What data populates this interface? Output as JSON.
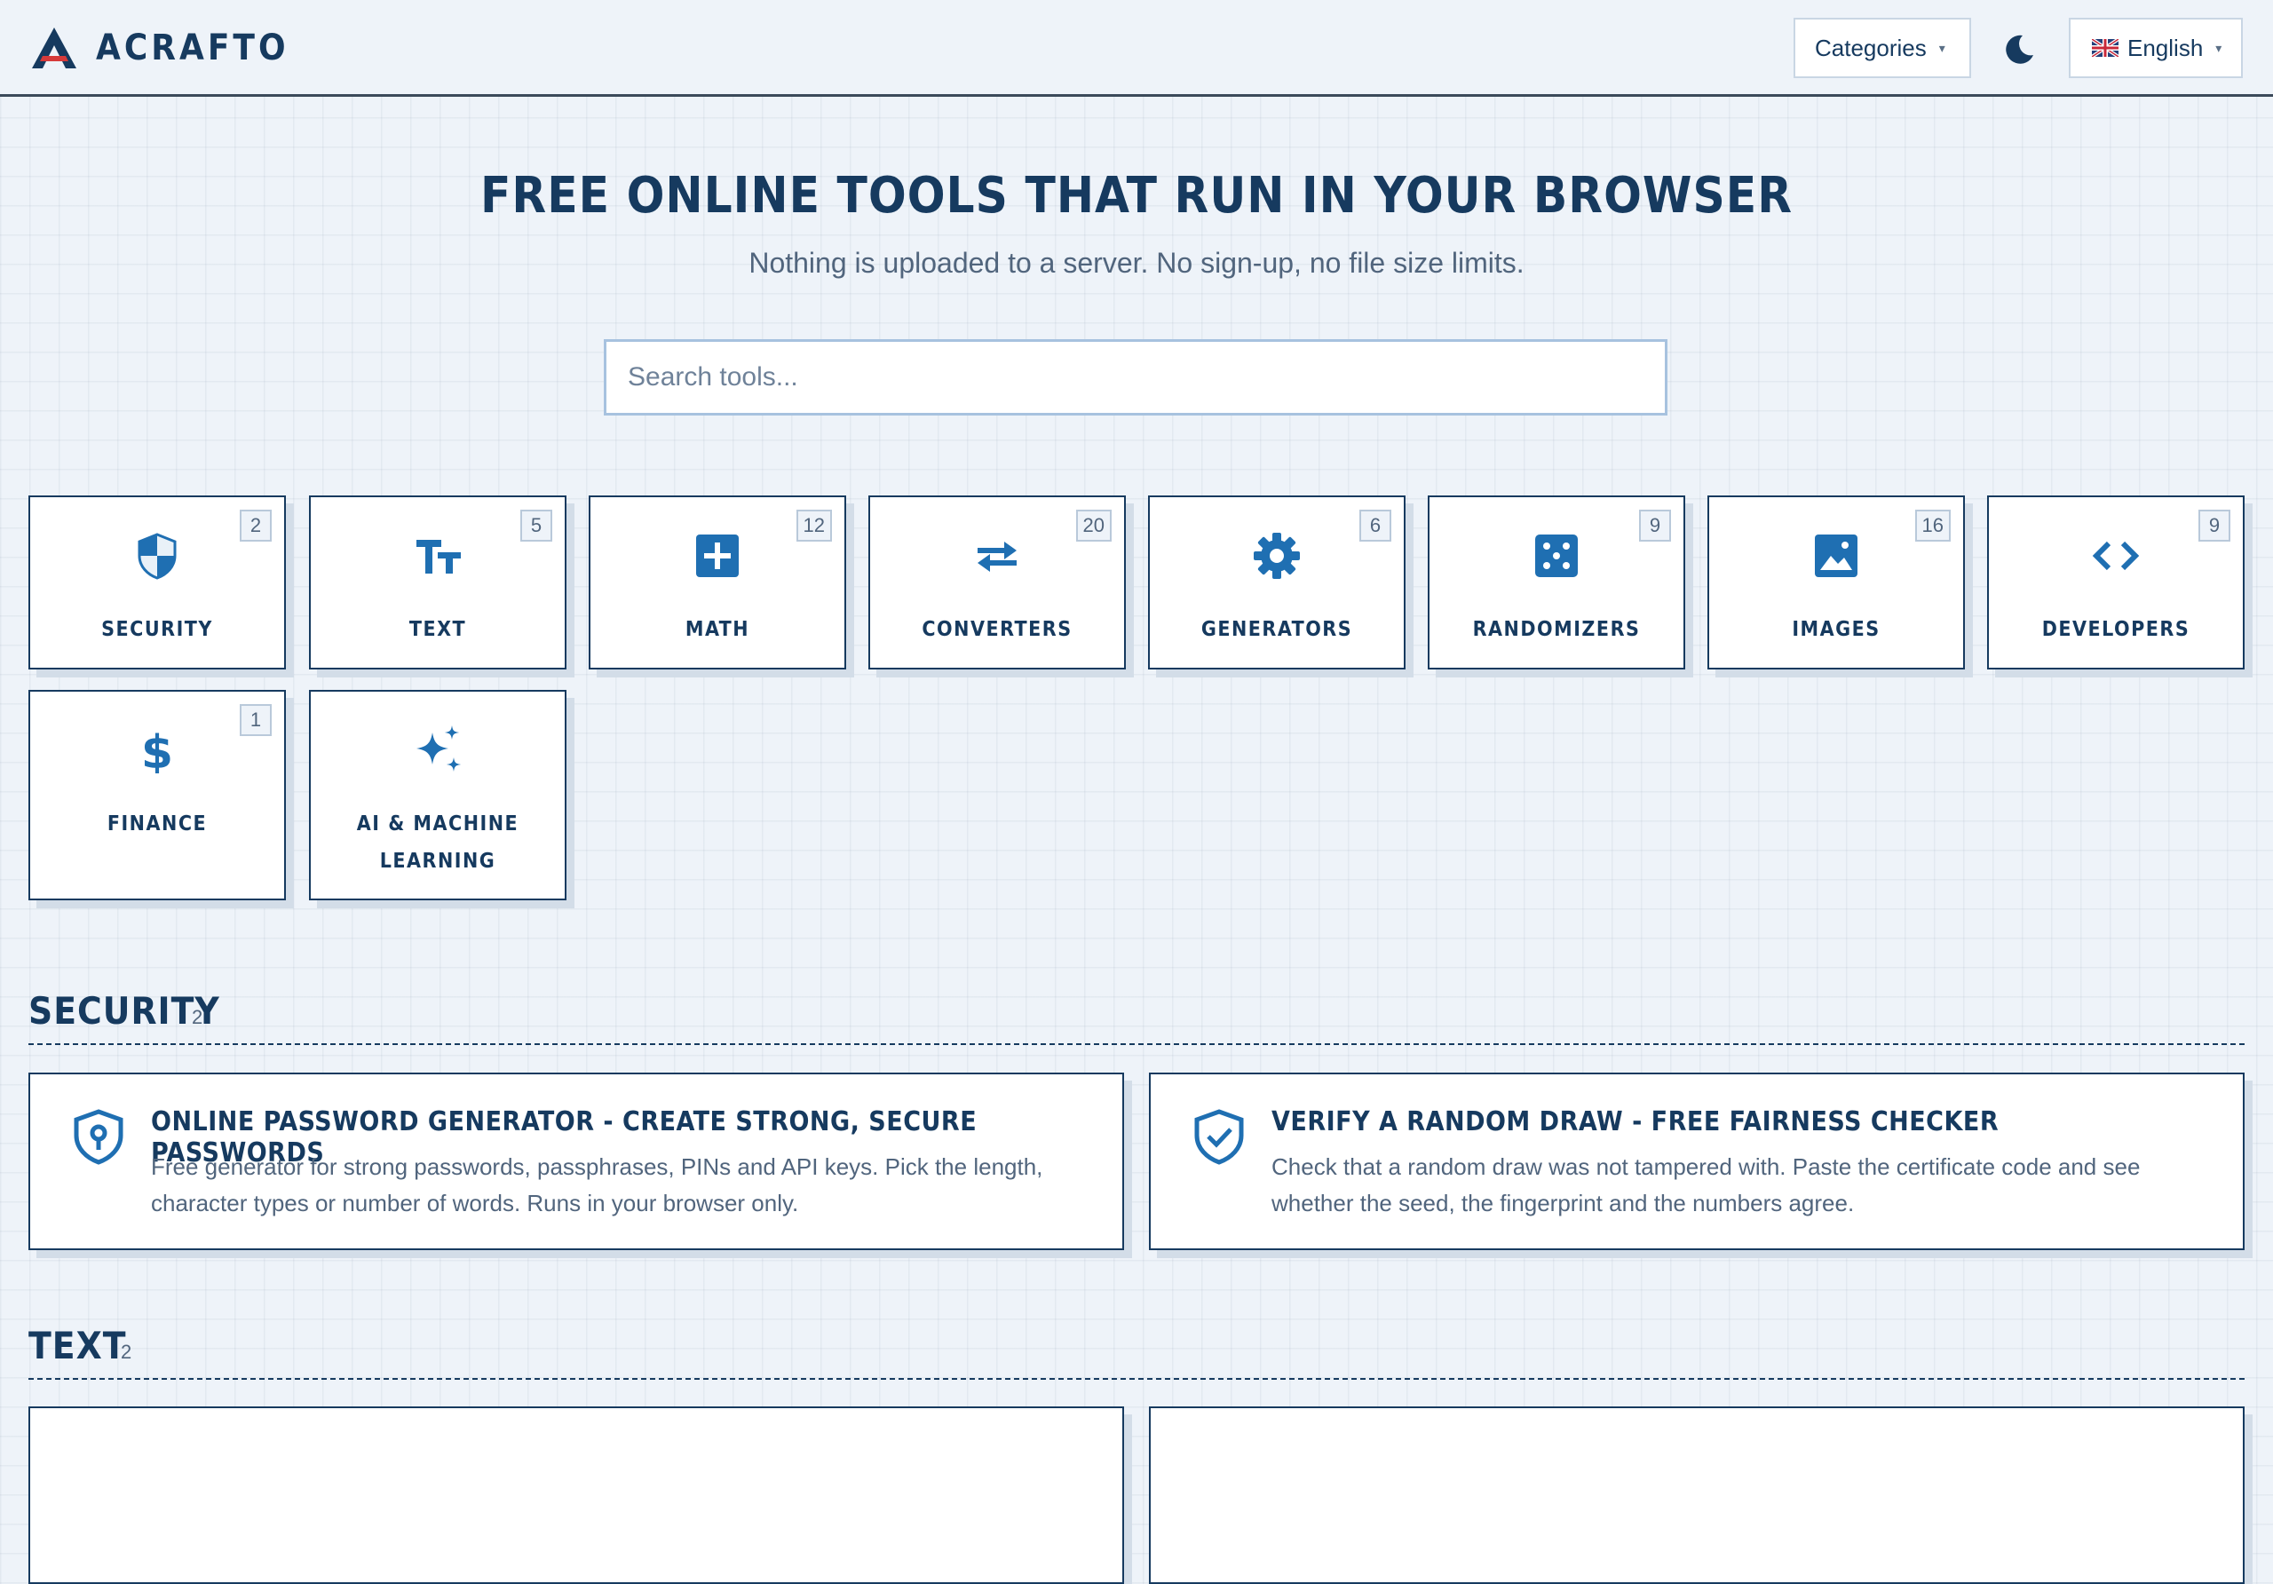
{
  "header": {
    "brand": "ACRAFTO",
    "categories_label": "Categories",
    "language_label": "English",
    "theme_icon": "moon-icon"
  },
  "hero": {
    "title": "FREE ONLINE TOOLS THAT RUN IN YOUR BROWSER",
    "subtitle": "Nothing is uploaded to a server. No sign-up, no file size limits.",
    "search_placeholder": "Search tools..."
  },
  "categories": [
    {
      "label": "SECURITY",
      "count": "2",
      "icon": "shield-icon"
    },
    {
      "label": "TEXT",
      "count": "5",
      "icon": "text-size-icon"
    },
    {
      "label": "MATH",
      "count": "12",
      "icon": "plus-square-icon"
    },
    {
      "label": "CONVERTERS",
      "count": "20",
      "icon": "arrows-swap-icon"
    },
    {
      "label": "GENERATORS",
      "count": "6",
      "icon": "gear-icon"
    },
    {
      "label": "RANDOMIZERS",
      "count": "9",
      "icon": "dice-icon"
    },
    {
      "label": "IMAGES",
      "count": "16",
      "icon": "image-icon"
    },
    {
      "label": "DEVELOPERS",
      "count": "9",
      "icon": "code-icon"
    },
    {
      "label": "FINANCE",
      "count": "1",
      "icon": "dollar-icon"
    },
    {
      "label": "AI & MACHINE LEARNING",
      "count": "",
      "icon": "sparkles-icon"
    }
  ],
  "sections": [
    {
      "title": "SECURITY",
      "count": "2",
      "tools": [
        {
          "title": "ONLINE PASSWORD GENERATOR - CREATE STRONG, SECURE PASSWORDS",
          "description": "Free generator for strong passwords, passphrases, PINs and API keys. Pick the length, character types or number of words. Runs in your browser only.",
          "icon": "shield-keyhole-icon"
        },
        {
          "title": "VERIFY A RANDOM DRAW - FREE FAIRNESS CHECKER",
          "description": "Check that a random draw was not tampered with. Paste the certificate code and see whether the seed, the fingerprint and the numbers agree.",
          "icon": "shield-check-icon"
        }
      ]
    },
    {
      "title": "TEXT",
      "count": "2"
    }
  ],
  "colors": {
    "accent": "#1f6fb2",
    "ink": "#163a5f",
    "muted": "#51657d",
    "background": "#eef3f9",
    "logo_red": "#d63a3a"
  }
}
